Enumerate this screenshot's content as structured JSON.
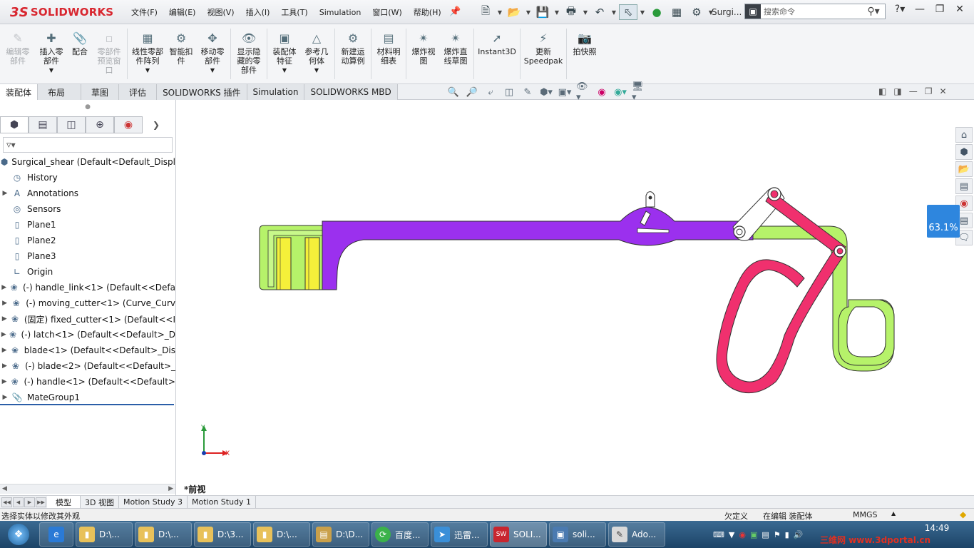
{
  "app": {
    "brand": "SOLIDWORKS",
    "brand_prefix": "3S",
    "doc_name": "Surgi...",
    "search_placeholder": "搜索命令"
  },
  "menu": [
    "文件(F)",
    "编辑(E)",
    "视图(V)",
    "插入(I)",
    "工具(T)",
    "Simulation",
    "窗口(W)",
    "帮助(H)"
  ],
  "ribbon": [
    {
      "label": "编辑零部件",
      "enabled": false
    },
    {
      "label": "插入零部件",
      "enabled": true
    },
    {
      "label": "配合",
      "enabled": true
    },
    {
      "label": "零部件预览窗口",
      "enabled": false
    },
    {
      "label": "线性零部件阵列",
      "enabled": true
    },
    {
      "label": "智能扣件",
      "enabled": true
    },
    {
      "label": "移动零部件",
      "enabled": true
    },
    {
      "label": "显示隐藏的零部件",
      "enabled": true
    },
    {
      "label": "装配体特征",
      "enabled": true
    },
    {
      "label": "参考几何体",
      "enabled": true
    },
    {
      "label": "新建运动算例",
      "enabled": true
    },
    {
      "label": "材料明细表",
      "enabled": true
    },
    {
      "label": "爆炸视图",
      "enabled": true
    },
    {
      "label": "爆炸直线草图",
      "enabled": true
    },
    {
      "label": "Instant3D",
      "enabled": true
    },
    {
      "label": "更新Speedpak",
      "enabled": true
    },
    {
      "label": "拍快照",
      "enabled": true
    }
  ],
  "cm_tabs": [
    "装配体",
    "布局",
    "草图",
    "评估",
    "SOLIDWORKS 插件",
    "Simulation",
    "SOLIDWORKS MBD"
  ],
  "tree": {
    "root": "Surgical_shear  (Default<Default_Displ",
    "items": [
      {
        "label": "History",
        "icon": "history-icon",
        "expandable": false
      },
      {
        "label": "Annotations",
        "icon": "annotations-icon",
        "expandable": true
      },
      {
        "label": "Sensors",
        "icon": "sensors-icon",
        "expandable": false
      },
      {
        "label": "Plane1",
        "icon": "plane-icon",
        "expandable": false
      },
      {
        "label": "Plane2",
        "icon": "plane-icon",
        "expandable": false
      },
      {
        "label": "Plane3",
        "icon": "plane-icon",
        "expandable": false
      },
      {
        "label": "Origin",
        "icon": "origin-icon",
        "expandable": false
      },
      {
        "label": "(-) handle_link<1> (Default<<Defa",
        "icon": "part-icon",
        "expandable": true
      },
      {
        "label": "(-) moving_cutter<1> (Curve_Curv",
        "icon": "part-icon",
        "expandable": true
      },
      {
        "label": "(固定) fixed_cutter<1> (Default<<I",
        "icon": "part-icon",
        "expandable": true
      },
      {
        "label": "(-) latch<1> (Default<<Default>_D",
        "icon": "part-icon",
        "expandable": true
      },
      {
        "label": "blade<1> (Default<<Default>_Dis",
        "icon": "part-icon",
        "expandable": true
      },
      {
        "label": "(-) blade<2> (Default<<Default>_",
        "icon": "part-icon",
        "expandable": true
      },
      {
        "label": "(-) handle<1> (Default<<Default>",
        "icon": "part-icon",
        "expandable": true
      },
      {
        "label": "MateGroup1",
        "icon": "mates-icon",
        "expandable": true
      }
    ]
  },
  "viewport": {
    "view_label": "*前视",
    "triad_y": "Y",
    "triad_x": "X",
    "badge": "63.1%"
  },
  "bottom_tabs": [
    "模型",
    "3D 视图",
    "Motion Study 3",
    "Motion Study 1"
  ],
  "status": {
    "left": "选择实体以修改其外观",
    "definition": "欠定义",
    "editing": "在编辑 装配体",
    "units": "MMGS"
  },
  "taskbar": {
    "items": [
      {
        "label": "",
        "icon": "ie-icon",
        "color": "#2a7ad6"
      },
      {
        "label": "D:\\...",
        "icon": "folder-icon",
        "color": "#e8c15a"
      },
      {
        "label": "D:\\...",
        "icon": "folder-icon",
        "color": "#e8c15a"
      },
      {
        "label": "D:\\3...",
        "icon": "folder-icon",
        "color": "#e8c15a"
      },
      {
        "label": "D:\\...",
        "icon": "folder-icon",
        "color": "#e8c15a"
      },
      {
        "label": "D:\\D...",
        "icon": "archive-icon",
        "color": "#c9a04a"
      },
      {
        "label": "百度...",
        "icon": "browser-icon",
        "color": "#3bb24a"
      },
      {
        "label": "迅雷...",
        "icon": "xunlei-icon",
        "color": "#3a8fd8"
      },
      {
        "label": "SOLI...",
        "icon": "solidworks-icon",
        "color": "#c8262f"
      },
      {
        "label": "soli...",
        "icon": "window-icon",
        "color": "#4a7ab0"
      },
      {
        "label": "Ado...",
        "icon": "pen-icon",
        "color": "#d9d9d9"
      }
    ],
    "time": "14:49",
    "watermark": "三维网 www.3dportal.cn"
  },
  "colors": {
    "fixed_cutter": "#b6f26a",
    "moving_cutter": "#9b30ee",
    "handle": "#f0306e",
    "blade": "#f5f03a"
  }
}
